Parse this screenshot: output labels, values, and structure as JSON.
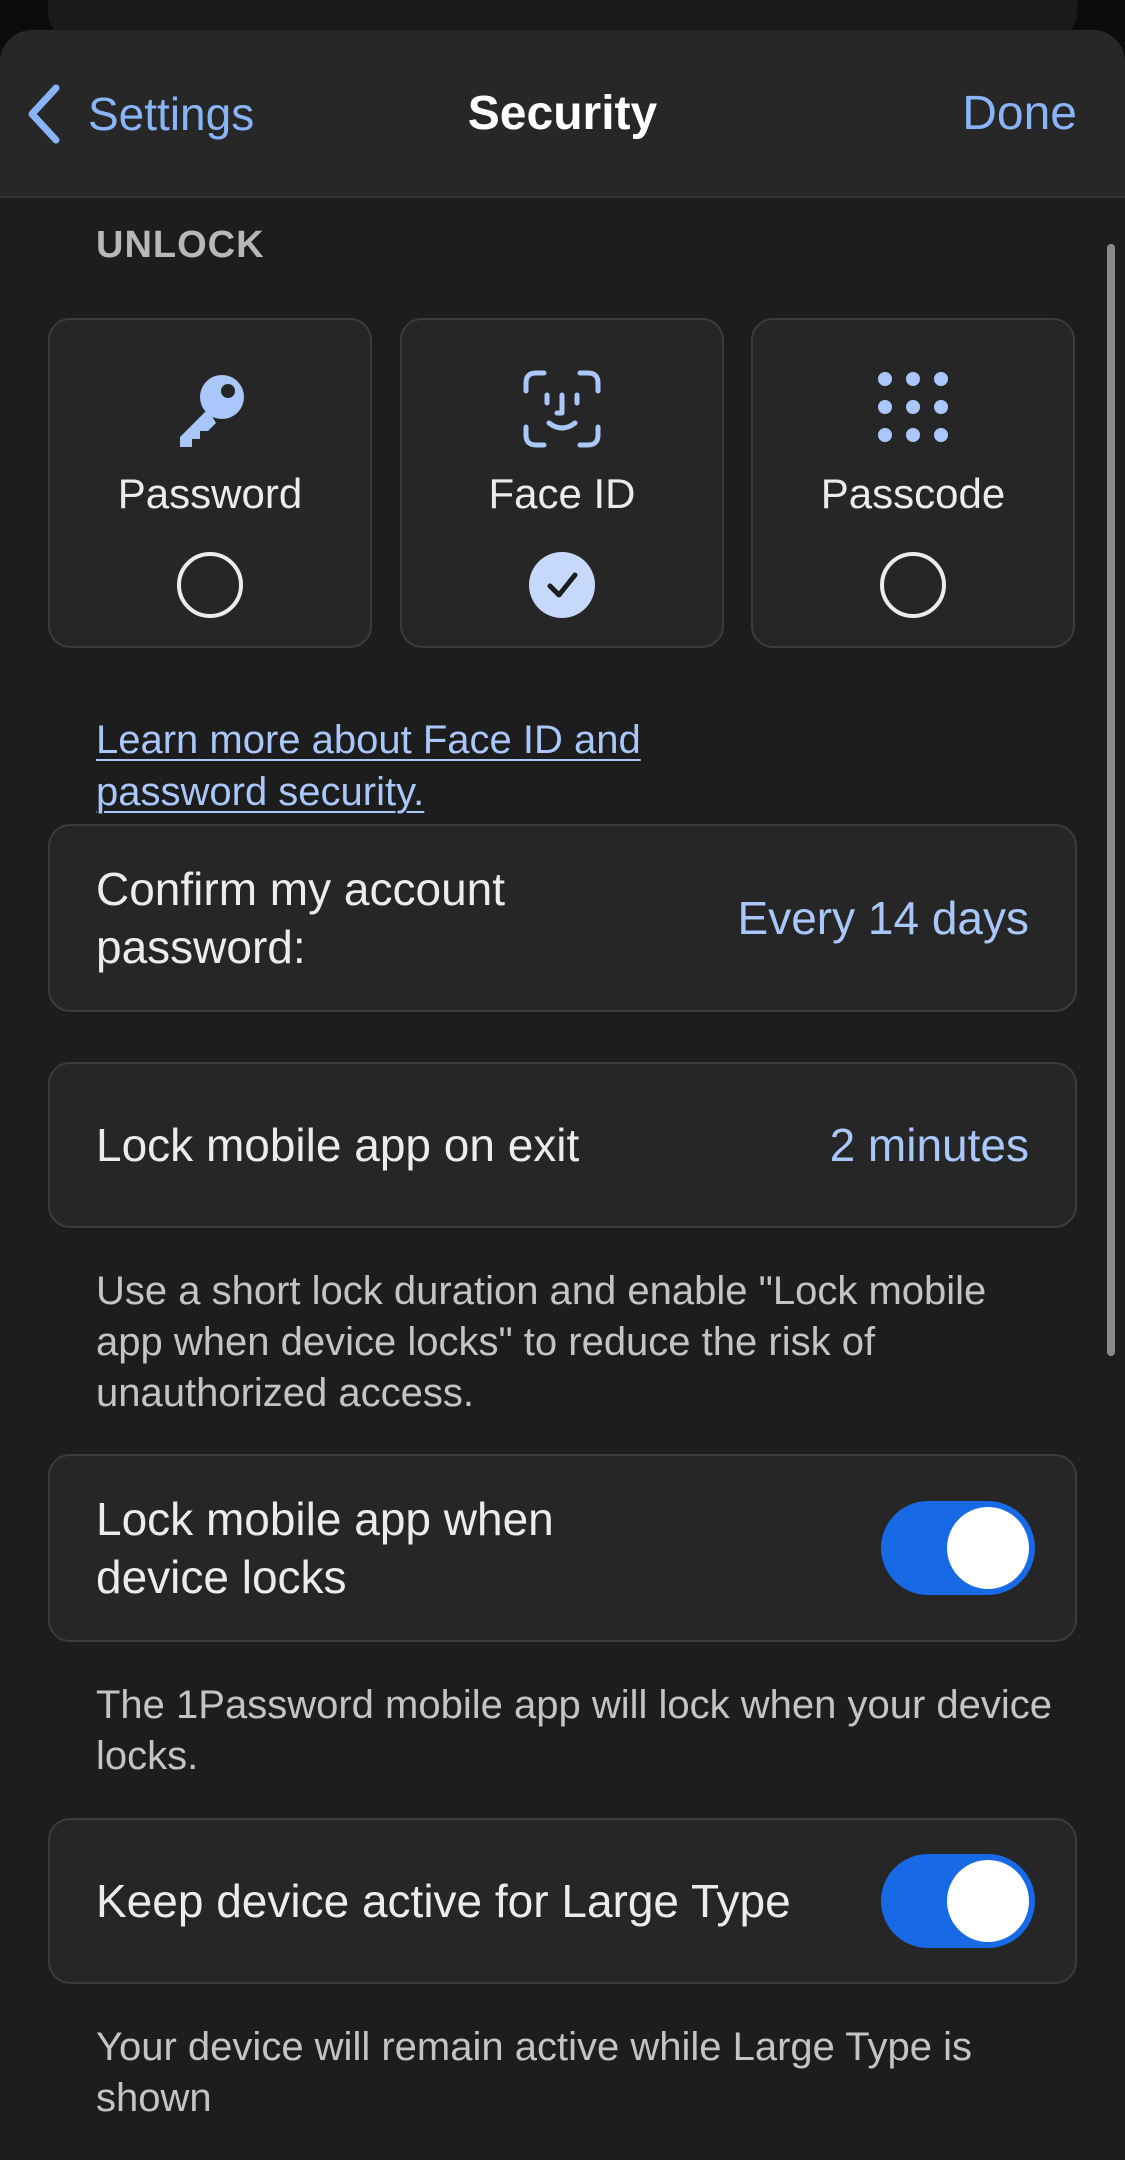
{
  "header": {
    "back_label": "Settings",
    "title": "Security",
    "done_label": "Done"
  },
  "unlock": {
    "section_title": "UNLOCK",
    "options": [
      {
        "label": "Password",
        "icon": "key-icon",
        "selected": false
      },
      {
        "label": "Face ID",
        "icon": "face-id-icon",
        "selected": true
      },
      {
        "label": "Passcode",
        "icon": "keypad-icon",
        "selected": false
      }
    ],
    "learn_more_link": "Learn more about Face ID and password security."
  },
  "confirm_password": {
    "label": "Confirm my account password:",
    "value": "Every 14 days"
  },
  "lock_on_exit": {
    "label": "Lock mobile app on exit",
    "value": "2 minutes",
    "help": "Use a short lock duration and enable \"Lock mobile app when device locks\" to reduce the risk of unauthorized access."
  },
  "lock_with_device": {
    "label": "Lock mobile app when device locks",
    "enabled": true,
    "help": "The 1Password mobile app will lock when your device locks."
  },
  "large_type": {
    "label": "Keep device active for Large Type",
    "enabled": true,
    "help": "Your device will remain active while Large Type is shown"
  },
  "colors": {
    "accent": "#8ab4f8",
    "toggle_on": "#1769e6",
    "background": "#1d1d1d",
    "card": "#262626"
  }
}
